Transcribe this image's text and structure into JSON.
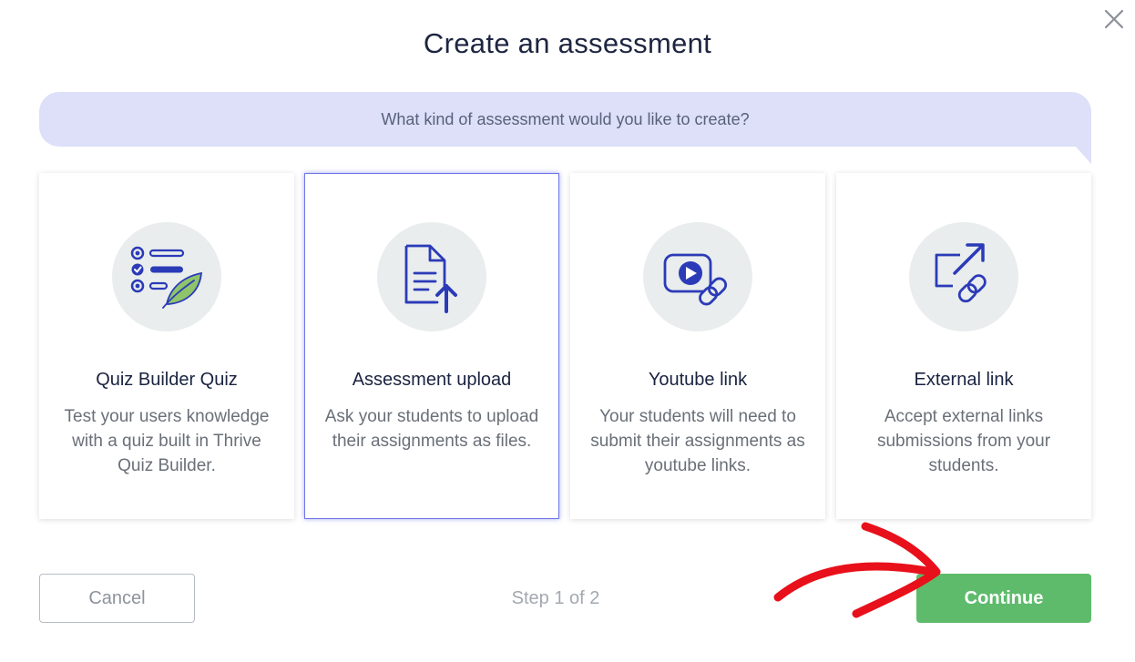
{
  "modal": {
    "title": "Create an assessment",
    "prompt": "What kind of assessment would you like to create?",
    "close_icon": "close-icon"
  },
  "options": [
    {
      "title": "Quiz Builder Quiz",
      "description": "Test your users knowledge with a quiz built in Thrive Quiz Builder.",
      "icon": "quiz-checklist-icon",
      "selected": false
    },
    {
      "title": "Assessment upload",
      "description": "Ask your students to upload their assignments as files.",
      "icon": "file-upload-icon",
      "selected": true
    },
    {
      "title": "Youtube link",
      "description": "Your students will need to submit their assignments as youtube links.",
      "icon": "video-link-icon",
      "selected": false
    },
    {
      "title": "External link",
      "description": "Accept external links submissions from your students.",
      "icon": "external-link-icon",
      "selected": false
    }
  ],
  "footer": {
    "cancel_label": "Cancel",
    "step_text": "Step 1 of 2",
    "continue_label": "Continue"
  },
  "colors": {
    "accent_blue": "#2b3bb8",
    "selected_border": "#6f76e6",
    "bubble_bg": "#dde0f8",
    "continue_green": "#5ebb6c",
    "leaf_green": "#8fc46a",
    "annotation_red": "#e8101a"
  }
}
